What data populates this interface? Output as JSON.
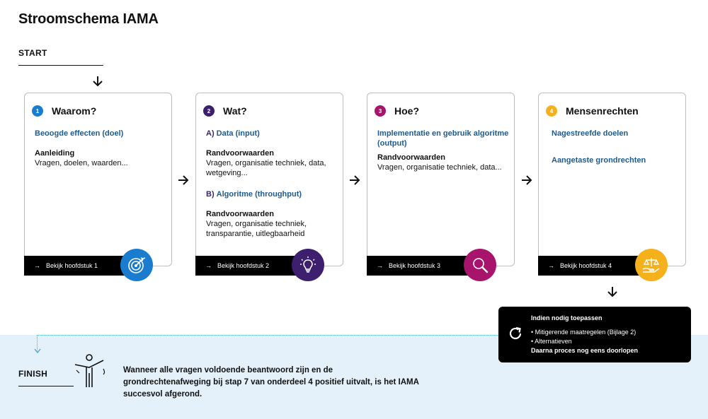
{
  "title": "Stroomschema IAMA",
  "start_label": "START",
  "finish_label": "FINISH",
  "finish_text": "Wanneer alle vragen voldoende beantwoord zijn en de grondrechtenafweging bij stap 7 van onderdeel 4 positief uitvalt, is het IAMA succesvol afgerond.",
  "colors": {
    "step1": "#1a7ccf",
    "step2": "#3d1f6e",
    "step3": "#a8136b",
    "step4": "#f5b11b",
    "link_blue": "#1c5b8f",
    "finish_bg": "#e5f1fa"
  },
  "steps": [
    {
      "number": "1",
      "title": "Waarom?",
      "subtitle": "Beoogde effecten (doel)",
      "group_title": "Aanleiding",
      "group_text": "Vragen, doelen, waarden...",
      "footer": "Bekijk hoofdstuk 1",
      "icon": "target-icon"
    },
    {
      "number": "2",
      "title": "Wat?",
      "section_a_prefix": "A)",
      "section_a_label": "Data (input)",
      "section_a_group": "Randvoorwaarden",
      "section_a_text": "Vragen, organisatie techniek, data, wetgeving...",
      "section_b_prefix": "B)",
      "section_b_label": "Algoritme (throughput)",
      "section_b_group": "Randvoorwaarden",
      "section_b_text": "Vragen, organisatie techniek, transparantie, uitlegbaarheid",
      "footer": "Bekijk hoofdstuk 2",
      "icon": "lightbulb-icon"
    },
    {
      "number": "3",
      "title": "Hoe?",
      "subtitle": "Implementatie en gebruik algoritme (output)",
      "group_title": "Randvoorwaarden",
      "group_text": "Vragen, organisatie techniek, data...",
      "footer": "Bekijk hoofdstuk 3",
      "icon": "magnifier-icon"
    },
    {
      "number": "4",
      "title": "Mensenrechten",
      "subtitle": "Nagestreefde doelen",
      "subtitle2": "Aangetaste grondrechten",
      "footer": "Bekijk hoofdstuk 4",
      "icon": "scales-hand-icon"
    }
  ],
  "popup": {
    "title": "Indien nodig toepassen",
    "items": [
      "Mitigerende maatregelen (Bijlage 2)",
      "Alternatieven"
    ],
    "footer": "Daarna proces nog eens doorlopen",
    "icon": "refresh-icon"
  }
}
